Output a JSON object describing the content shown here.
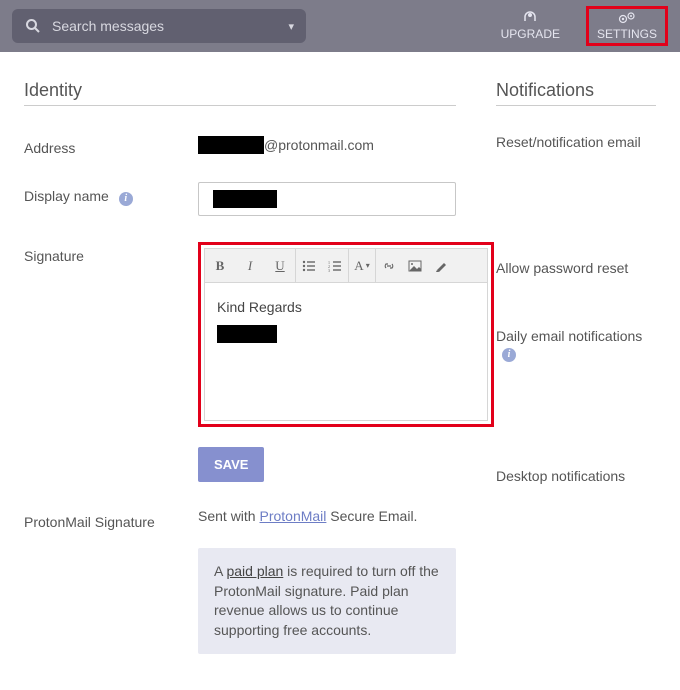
{
  "topbar": {
    "search_placeholder": "Search messages",
    "upgrade_label": "UPGRADE",
    "settings_label": "SETTINGS"
  },
  "identity": {
    "title": "Identity",
    "address_label": "Address",
    "address_domain": "@protonmail.com",
    "display_name_label": "Display name",
    "signature_label": "Signature",
    "signature_text": "Kind Regards",
    "save_label": "SAVE",
    "pm_sig_label": "ProtonMail Signature",
    "pm_sig_prefix": "Sent with ",
    "pm_sig_link": "ProtonMail",
    "pm_sig_suffix": " Secure Email.",
    "callout_a": "A ",
    "callout_paid": "paid plan",
    "callout_rest": " is required to turn off the ProtonMail signature. Paid plan revenue allows us to continue supporting free accounts."
  },
  "notifications": {
    "title": "Notifications",
    "reset_label": "Reset/notification email",
    "allow_label": "Allow password reset",
    "daily_label": "Daily email notifications",
    "desktop_label": "Desktop notifications"
  }
}
